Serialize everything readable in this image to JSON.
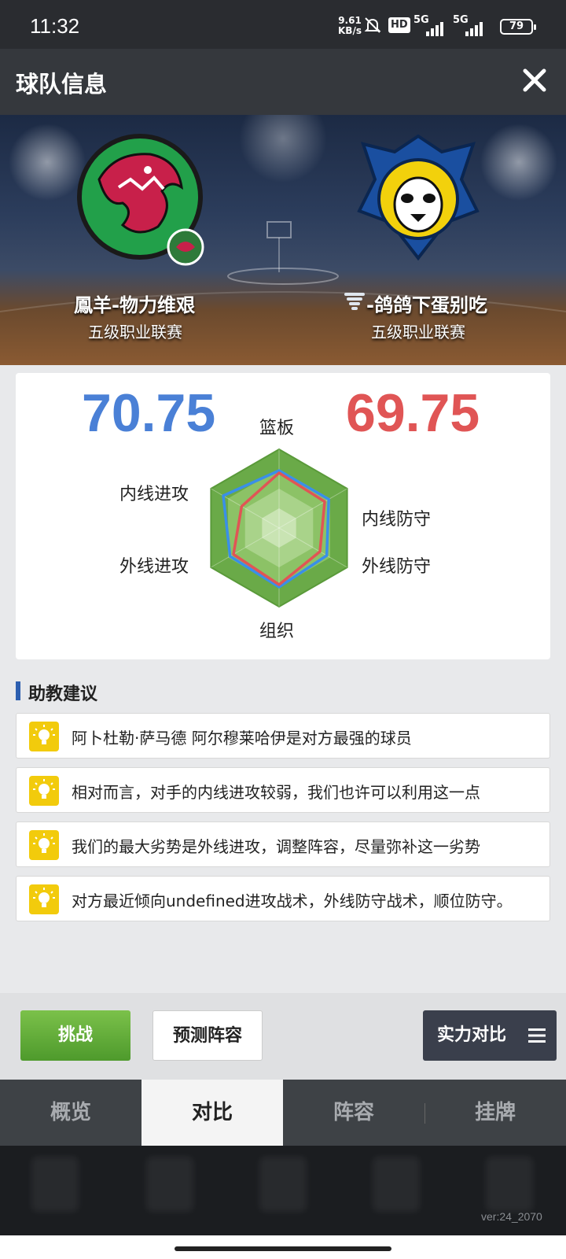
{
  "status": {
    "time": "11:32",
    "net_speed_value": "9.61",
    "net_speed_unit": "KB/s",
    "hd_label": "HD",
    "signal1_label": "5G",
    "signal2_label": "5G",
    "battery": "79"
  },
  "header": {
    "title": "球队信息"
  },
  "banner": {
    "left_team": {
      "name": "鳳羊-物力维艰",
      "league": "五级职业联赛"
    },
    "right_team": {
      "name": "-鸽鸽下蛋别吃",
      "league": "五级职业联赛"
    }
  },
  "compare": {
    "left_score": "70.75",
    "right_score": "69.75",
    "left_color": "#4a80d6",
    "right_color": "#e05555",
    "axes": {
      "top": "篮板",
      "upper_right": "内线防守",
      "lower_right": "外线防守",
      "bottom": "组织",
      "lower_left": "外线进攻",
      "upper_left": "内线进攻"
    }
  },
  "chart_data": {
    "type": "radar",
    "axes": [
      "篮板",
      "内线防守",
      "外线防守",
      "组织",
      "外线进攻",
      "内线进攻"
    ],
    "series": [
      {
        "name": "",
        "color": "#3a8fe8",
        "values": [
          0.73,
          0.73,
          0.7,
          0.75,
          0.72,
          0.82
        ]
      },
      {
        "name": "",
        "color": "#e05555",
        "values": [
          0.7,
          0.67,
          0.6,
          0.72,
          0.67,
          0.55
        ]
      }
    ],
    "range": [
      0,
      1
    ]
  },
  "advice": {
    "title": "助教建议",
    "items": [
      "阿卜杜勒·萨马德 阿尔穆莱哈伊是对方最强的球员",
      "相对而言，对手的内线进攻较弱，我们也许可以利用这一点",
      "我们的最大劣势是外线进攻，调整阵容，尽量弥补这一劣势",
      "对方最近倾向undefined进攻战术，外线防守战术，顺位防守。"
    ]
  },
  "actions": {
    "challenge": "挑战",
    "predict": "预测阵容",
    "strength": "实力对比"
  },
  "tabs": [
    "概览",
    "对比",
    "阵容",
    "挂牌"
  ],
  "version": "ver:24_2070"
}
